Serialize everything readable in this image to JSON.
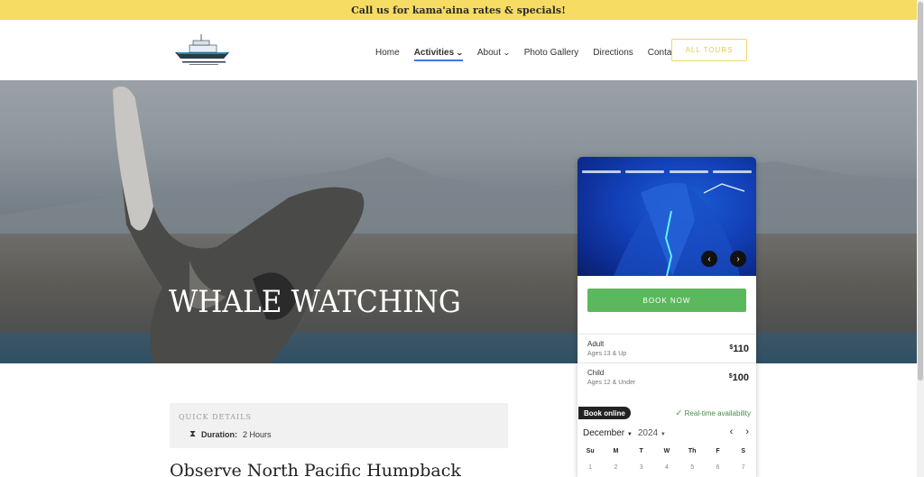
{
  "topbar": {
    "text": "Call us for kama'aina rates & specials!"
  },
  "nav": {
    "items": [
      {
        "label": "Home"
      },
      {
        "label": "Activities"
      },
      {
        "label": "About"
      },
      {
        "label": "Photo Gallery"
      },
      {
        "label": "Directions"
      },
      {
        "label": "Contact"
      }
    ],
    "all_tours": "ALL TOURS"
  },
  "hero": {
    "title": "WHALE WATCHING"
  },
  "booking": {
    "book_now": "BOOK NOW",
    "prices": [
      {
        "name": "Adult",
        "ages": "Ages 13 & Up",
        "currency": "$",
        "amount": "110"
      },
      {
        "name": "Child",
        "ages": "Ages 12 & Under",
        "currency": "$",
        "amount": "100"
      }
    ],
    "book_online": "Book online",
    "realtime": "Real-time availability",
    "calendar": {
      "month": "December",
      "year": "2024",
      "weekdays": [
        "Su",
        "M",
        "T",
        "W",
        "Th",
        "F",
        "S"
      ],
      "first_row": [
        "1",
        "2",
        "3",
        "4",
        "5",
        "6",
        "7"
      ]
    }
  },
  "quick_details": {
    "title": "QUICK DETAILS",
    "duration_label": "Duration:",
    "duration_value": "2 Hours"
  },
  "main": {
    "subtitle": "Observe North Pacific Humpback"
  },
  "colors": {
    "topbar": "#f7dc63",
    "book_now": "#5cb85c",
    "accent": "#3a7bd5"
  }
}
